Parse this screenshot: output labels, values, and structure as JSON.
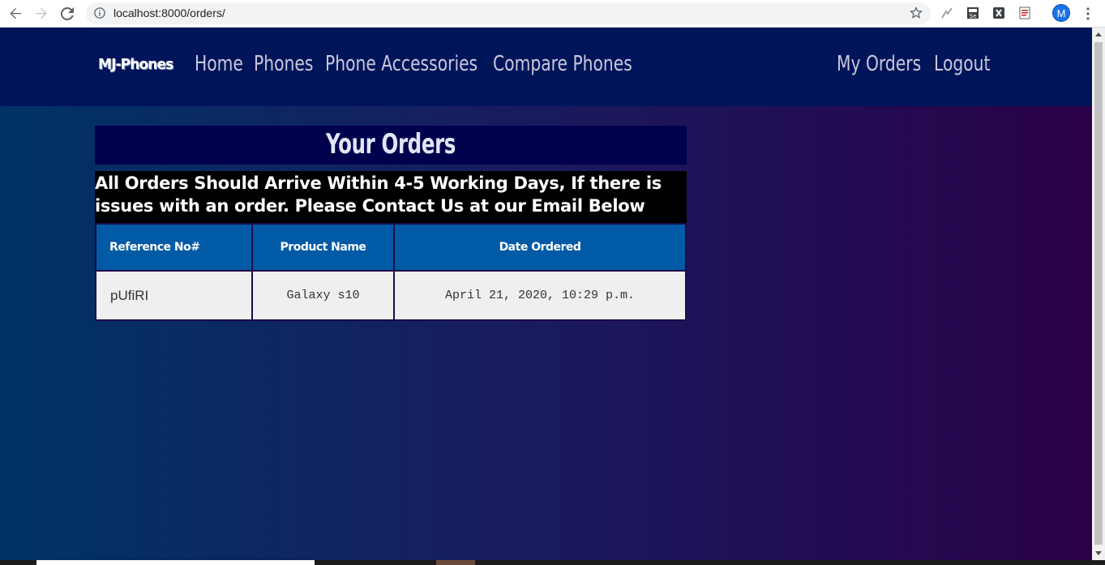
{
  "browser": {
    "url": "localhost:8000/orders/",
    "avatar_letter": "M",
    "icons": [
      "back-arrow-icon",
      "forward-arrow-icon",
      "reload-icon",
      "info-icon",
      "star-icon",
      "lightning-extension-icon",
      "selenium-extension-icon",
      "excel-extension-icon",
      "pdf-extension-icon",
      "menu-dots-icon"
    ]
  },
  "nav": {
    "brand": "MJ-Phones",
    "links": [
      "Home",
      "Phones",
      "Phone Accessories",
      "Compare Phones"
    ],
    "right_links": [
      "My Orders",
      "Logout"
    ]
  },
  "page": {
    "title": "Your Orders",
    "notice": "All Orders Should Arrive Within 4-5 Working Days, If there is issues with an order. Please Contact Us at our Email Below"
  },
  "orders": {
    "headers": [
      "Reference No#",
      "Product Name",
      "Date Ordered"
    ],
    "rows": [
      [
        "pUfiRI",
        "Galaxy s10",
        "April 21, 2020, 10:29 p.m."
      ]
    ]
  },
  "colors": {
    "nav_bg": "#001459",
    "header_bg": "#005aa6",
    "title_bg": "#00004d"
  }
}
